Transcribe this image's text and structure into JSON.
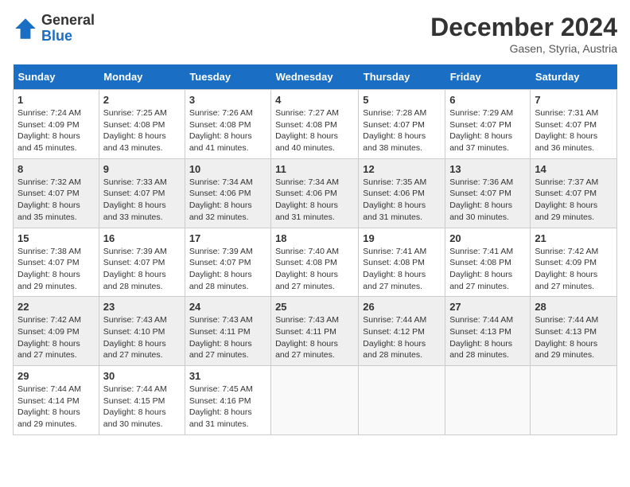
{
  "header": {
    "logo_general": "General",
    "logo_blue": "Blue",
    "month_title": "December 2024",
    "location": "Gasen, Styria, Austria"
  },
  "weekdays": [
    "Sunday",
    "Monday",
    "Tuesday",
    "Wednesday",
    "Thursday",
    "Friday",
    "Saturday"
  ],
  "weeks": [
    [
      {
        "day": "1",
        "sunrise": "Sunrise: 7:24 AM",
        "sunset": "Sunset: 4:09 PM",
        "daylight": "Daylight: 8 hours and 45 minutes."
      },
      {
        "day": "2",
        "sunrise": "Sunrise: 7:25 AM",
        "sunset": "Sunset: 4:08 PM",
        "daylight": "Daylight: 8 hours and 43 minutes."
      },
      {
        "day": "3",
        "sunrise": "Sunrise: 7:26 AM",
        "sunset": "Sunset: 4:08 PM",
        "daylight": "Daylight: 8 hours and 41 minutes."
      },
      {
        "day": "4",
        "sunrise": "Sunrise: 7:27 AM",
        "sunset": "Sunset: 4:08 PM",
        "daylight": "Daylight: 8 hours and 40 minutes."
      },
      {
        "day": "5",
        "sunrise": "Sunrise: 7:28 AM",
        "sunset": "Sunset: 4:07 PM",
        "daylight": "Daylight: 8 hours and 38 minutes."
      },
      {
        "day": "6",
        "sunrise": "Sunrise: 7:29 AM",
        "sunset": "Sunset: 4:07 PM",
        "daylight": "Daylight: 8 hours and 37 minutes."
      },
      {
        "day": "7",
        "sunrise": "Sunrise: 7:31 AM",
        "sunset": "Sunset: 4:07 PM",
        "daylight": "Daylight: 8 hours and 36 minutes."
      }
    ],
    [
      {
        "day": "8",
        "sunrise": "Sunrise: 7:32 AM",
        "sunset": "Sunset: 4:07 PM",
        "daylight": "Daylight: 8 hours and 35 minutes."
      },
      {
        "day": "9",
        "sunrise": "Sunrise: 7:33 AM",
        "sunset": "Sunset: 4:07 PM",
        "daylight": "Daylight: 8 hours and 33 minutes."
      },
      {
        "day": "10",
        "sunrise": "Sunrise: 7:34 AM",
        "sunset": "Sunset: 4:06 PM",
        "daylight": "Daylight: 8 hours and 32 minutes."
      },
      {
        "day": "11",
        "sunrise": "Sunrise: 7:34 AM",
        "sunset": "Sunset: 4:06 PM",
        "daylight": "Daylight: 8 hours and 31 minutes."
      },
      {
        "day": "12",
        "sunrise": "Sunrise: 7:35 AM",
        "sunset": "Sunset: 4:06 PM",
        "daylight": "Daylight: 8 hours and 31 minutes."
      },
      {
        "day": "13",
        "sunrise": "Sunrise: 7:36 AM",
        "sunset": "Sunset: 4:07 PM",
        "daylight": "Daylight: 8 hours and 30 minutes."
      },
      {
        "day": "14",
        "sunrise": "Sunrise: 7:37 AM",
        "sunset": "Sunset: 4:07 PM",
        "daylight": "Daylight: 8 hours and 29 minutes."
      }
    ],
    [
      {
        "day": "15",
        "sunrise": "Sunrise: 7:38 AM",
        "sunset": "Sunset: 4:07 PM",
        "daylight": "Daylight: 8 hours and 29 minutes."
      },
      {
        "day": "16",
        "sunrise": "Sunrise: 7:39 AM",
        "sunset": "Sunset: 4:07 PM",
        "daylight": "Daylight: 8 hours and 28 minutes."
      },
      {
        "day": "17",
        "sunrise": "Sunrise: 7:39 AM",
        "sunset": "Sunset: 4:07 PM",
        "daylight": "Daylight: 8 hours and 28 minutes."
      },
      {
        "day": "18",
        "sunrise": "Sunrise: 7:40 AM",
        "sunset": "Sunset: 4:08 PM",
        "daylight": "Daylight: 8 hours and 27 minutes."
      },
      {
        "day": "19",
        "sunrise": "Sunrise: 7:41 AM",
        "sunset": "Sunset: 4:08 PM",
        "daylight": "Daylight: 8 hours and 27 minutes."
      },
      {
        "day": "20",
        "sunrise": "Sunrise: 7:41 AM",
        "sunset": "Sunset: 4:08 PM",
        "daylight": "Daylight: 8 hours and 27 minutes."
      },
      {
        "day": "21",
        "sunrise": "Sunrise: 7:42 AM",
        "sunset": "Sunset: 4:09 PM",
        "daylight": "Daylight: 8 hours and 27 minutes."
      }
    ],
    [
      {
        "day": "22",
        "sunrise": "Sunrise: 7:42 AM",
        "sunset": "Sunset: 4:09 PM",
        "daylight": "Daylight: 8 hours and 27 minutes."
      },
      {
        "day": "23",
        "sunrise": "Sunrise: 7:43 AM",
        "sunset": "Sunset: 4:10 PM",
        "daylight": "Daylight: 8 hours and 27 minutes."
      },
      {
        "day": "24",
        "sunrise": "Sunrise: 7:43 AM",
        "sunset": "Sunset: 4:11 PM",
        "daylight": "Daylight: 8 hours and 27 minutes."
      },
      {
        "day": "25",
        "sunrise": "Sunrise: 7:43 AM",
        "sunset": "Sunset: 4:11 PM",
        "daylight": "Daylight: 8 hours and 27 minutes."
      },
      {
        "day": "26",
        "sunrise": "Sunrise: 7:44 AM",
        "sunset": "Sunset: 4:12 PM",
        "daylight": "Daylight: 8 hours and 28 minutes."
      },
      {
        "day": "27",
        "sunrise": "Sunrise: 7:44 AM",
        "sunset": "Sunset: 4:13 PM",
        "daylight": "Daylight: 8 hours and 28 minutes."
      },
      {
        "day": "28",
        "sunrise": "Sunrise: 7:44 AM",
        "sunset": "Sunset: 4:13 PM",
        "daylight": "Daylight: 8 hours and 29 minutes."
      }
    ],
    [
      {
        "day": "29",
        "sunrise": "Sunrise: 7:44 AM",
        "sunset": "Sunset: 4:14 PM",
        "daylight": "Daylight: 8 hours and 29 minutes."
      },
      {
        "day": "30",
        "sunrise": "Sunrise: 7:44 AM",
        "sunset": "Sunset: 4:15 PM",
        "daylight": "Daylight: 8 hours and 30 minutes."
      },
      {
        "day": "31",
        "sunrise": "Sunrise: 7:45 AM",
        "sunset": "Sunset: 4:16 PM",
        "daylight": "Daylight: 8 hours and 31 minutes."
      },
      null,
      null,
      null,
      null
    ]
  ]
}
